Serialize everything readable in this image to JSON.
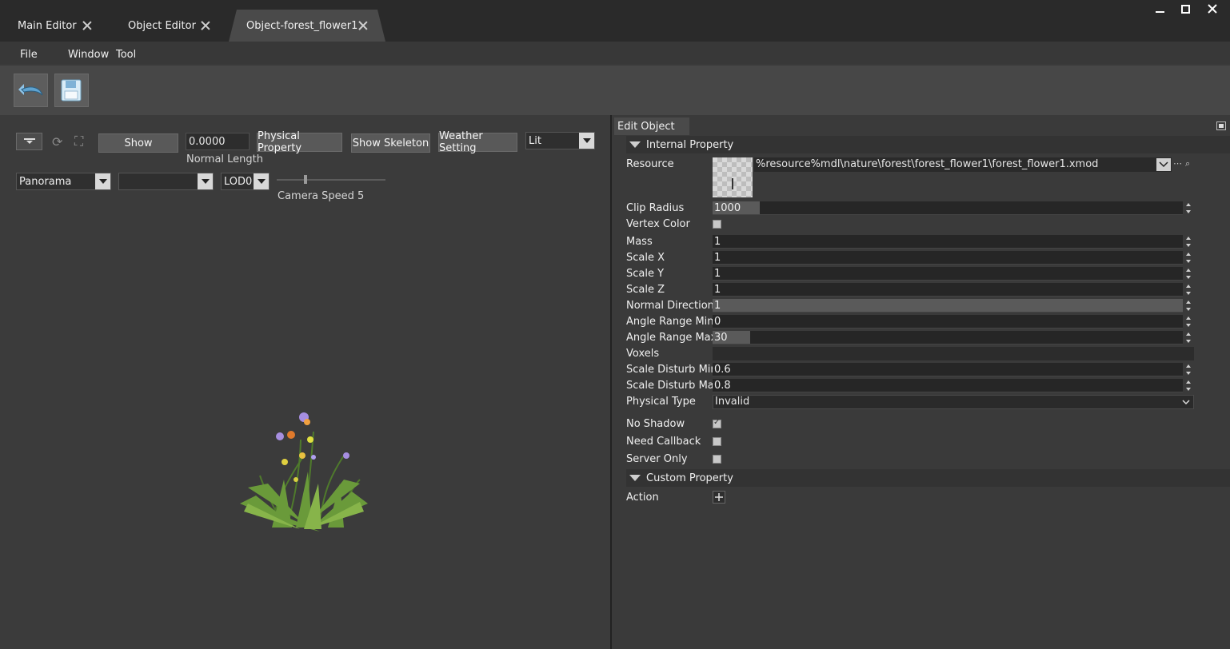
{
  "tabs": [
    {
      "label": "Main Editor"
    },
    {
      "label": "Object Editor"
    },
    {
      "label": "Object-forest_flower1"
    }
  ],
  "menu": [
    "File",
    "Window",
    "Tool"
  ],
  "viewport": {
    "show_label": "Show",
    "normal_length_value": "0.0000",
    "normal_length_label": "Normal Length",
    "physical_property_label": "Physical Property",
    "show_skeleton_label": "Show Skeleton",
    "weather_setting_label": "Weather Setting",
    "lighting_mode": "Lit",
    "camera_mode": "Panorama",
    "secondary_select": "",
    "lod": "LOD0",
    "camera_speed_label": "Camera Speed 5",
    "camera_speed": 5
  },
  "panel": {
    "title": "Edit Object",
    "internal_section": "Internal Property",
    "custom_section": "Custom Property",
    "resource_label": "Resource",
    "resource_path": "%resource%mdl\\nature\\forest\\forest_flower1\\forest_flower1.xmod",
    "props": [
      {
        "label": "Clip Radius",
        "value": "1000",
        "fill": 0.1
      },
      {
        "label": "Mass",
        "value": "1",
        "fill": 0
      },
      {
        "label": "Scale X",
        "value": "1",
        "fill": 0
      },
      {
        "label": "Scale Y",
        "value": "1",
        "fill": 0
      },
      {
        "label": "Scale Z",
        "value": "1",
        "fill": 0
      },
      {
        "label": "Normal Direction",
        "value": "1",
        "fill": 1
      },
      {
        "label": "Angle Range Min",
        "value": "0",
        "fill": 0
      },
      {
        "label": "Angle Range Max",
        "value": "30",
        "fill": 0.08
      },
      {
        "label": "Scale Disturb Min",
        "value": "0.6",
        "fill": 0
      },
      {
        "label": "Scale Disturb Max",
        "value": "0.8",
        "fill": 0
      }
    ],
    "vertex_color_label": "Vertex Color",
    "voxels_label": "Voxels",
    "physical_type_label": "Physical Type",
    "physical_type_value": "Invalid",
    "no_shadow_label": "No Shadow",
    "need_callback_label": "Need Callback",
    "server_only_label": "Server Only",
    "action_label": "Action"
  },
  "colors": {
    "background": "#3a3a3a",
    "tabbar": "#2a2a2a",
    "field": "#262626"
  }
}
